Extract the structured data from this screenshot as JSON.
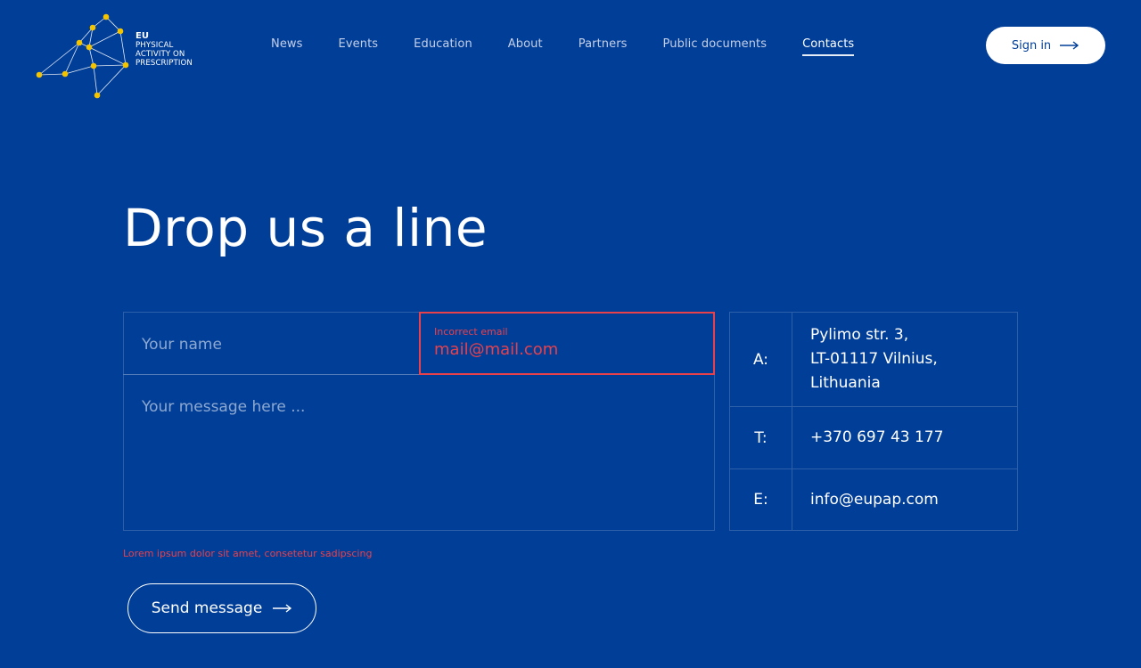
{
  "brand": {
    "logo_lines": [
      "EU",
      "PHYSICAL",
      "ACTIVITY ON",
      "PRESCRIPTION"
    ],
    "accent_color": "#F5C400",
    "background_color": "#003E98"
  },
  "nav": {
    "items": [
      {
        "label": "News",
        "active": false
      },
      {
        "label": "Events",
        "active": false
      },
      {
        "label": "Education",
        "active": false
      },
      {
        "label": "About",
        "active": false
      },
      {
        "label": "Partners",
        "active": false
      },
      {
        "label": "Public documents",
        "active": false
      },
      {
        "label": "Contacts",
        "active": true
      }
    ],
    "signin_label": "Sign in",
    "signin_icon": "arrow-right-icon"
  },
  "page": {
    "title": "Drop us a line"
  },
  "form": {
    "name_placeholder": "Your name",
    "email_error_label": "Incorrect email",
    "email_value": "mail@mail.com",
    "message_placeholder": "Your message here ...",
    "note": "Lorem ipsum dolor sit amet, consetetur sadipscing",
    "submit_label": "Send message",
    "submit_icon": "arrow-right-icon",
    "error_color": "#E8414C"
  },
  "contact": {
    "address_key": "A:",
    "address_lines": [
      "Pylimo str. 3,",
      "LT-01117 Vilnius,",
      "Lithuania"
    ],
    "phone_key": "T:",
    "phone_value": "+370 697 43 177",
    "email_key": "E:",
    "email_value": "info@eupap.com"
  }
}
